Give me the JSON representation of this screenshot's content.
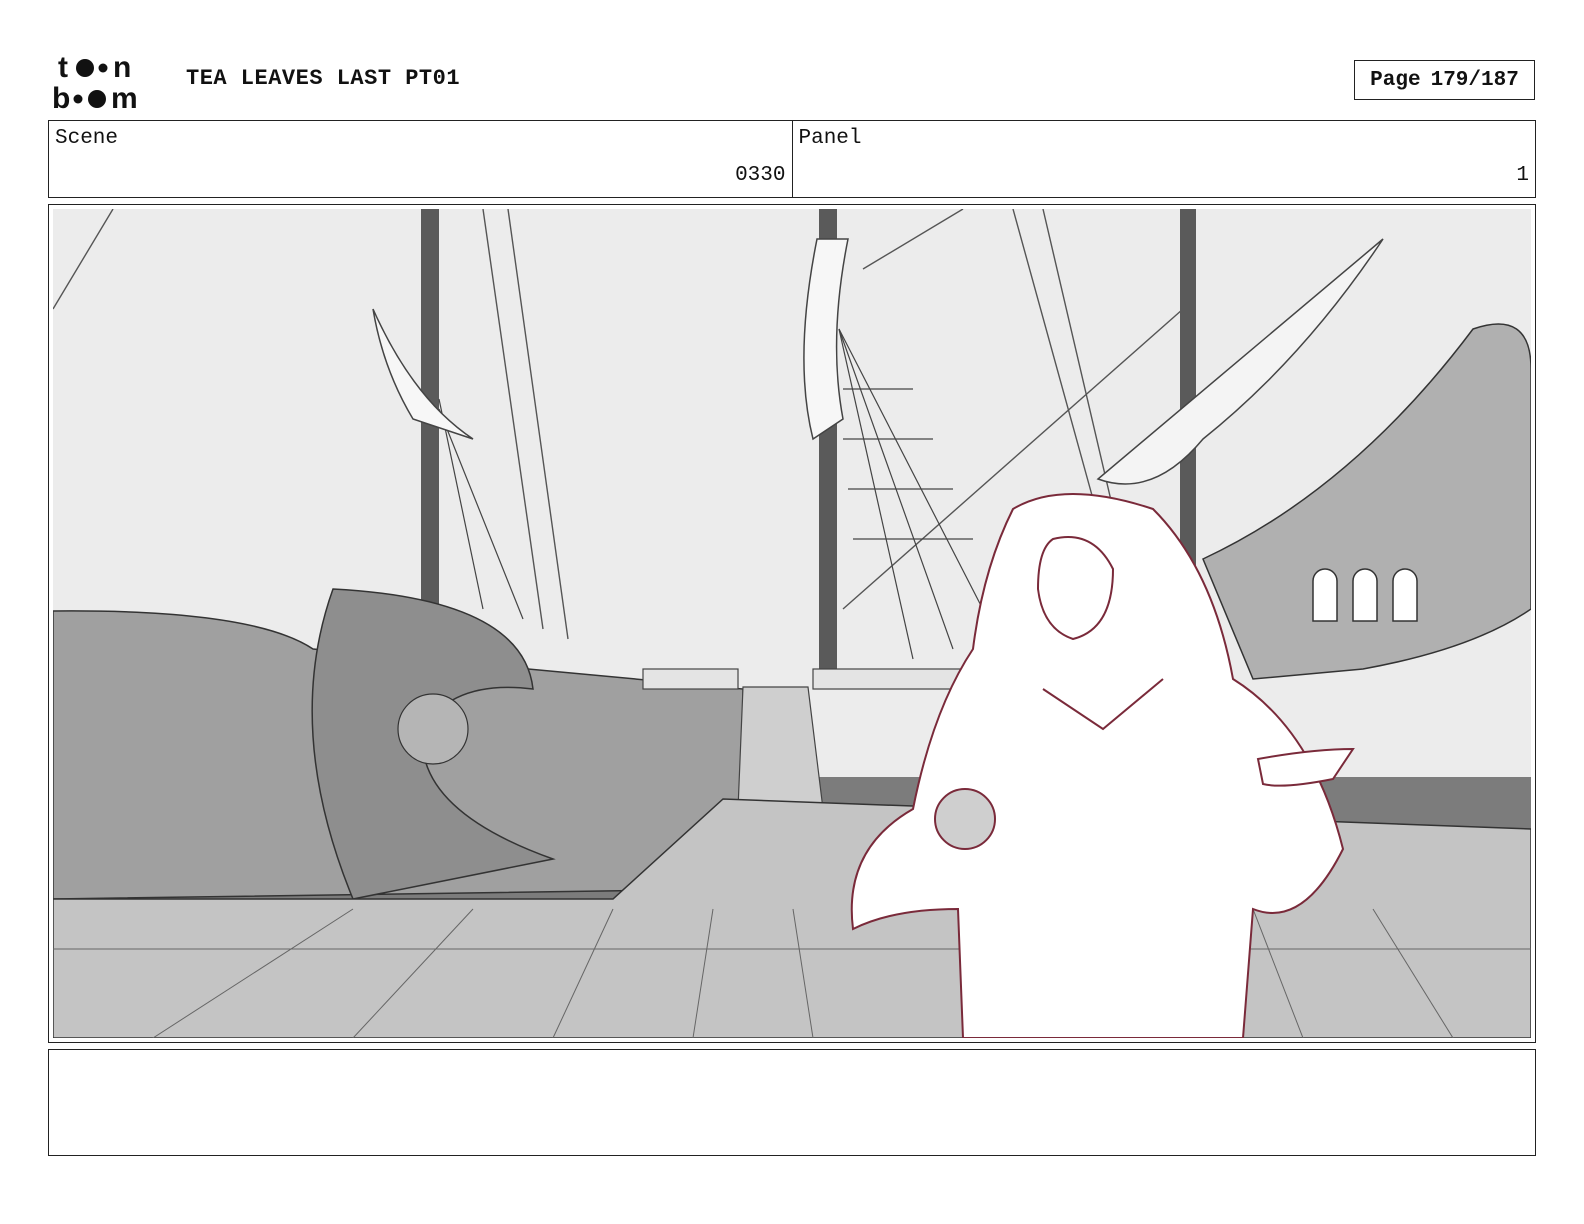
{
  "header": {
    "logo": {
      "top_text": "toon",
      "bottom_text": "boom"
    },
    "project_title": "TEA LEAVES LAST PT01",
    "page": {
      "label": "Page",
      "value": "179/187"
    }
  },
  "info": {
    "scene_label": "Scene",
    "scene_value": "0330",
    "panel_label": "Panel",
    "panel_value": "1"
  },
  "notes": {
    "text": ""
  },
  "colors": {
    "sky": "#e9e9e9",
    "sea": "#7a7a7a",
    "ship": "#9a9a9a",
    "deck": "#bdbdbd",
    "character_line": "#7a2a3a"
  }
}
